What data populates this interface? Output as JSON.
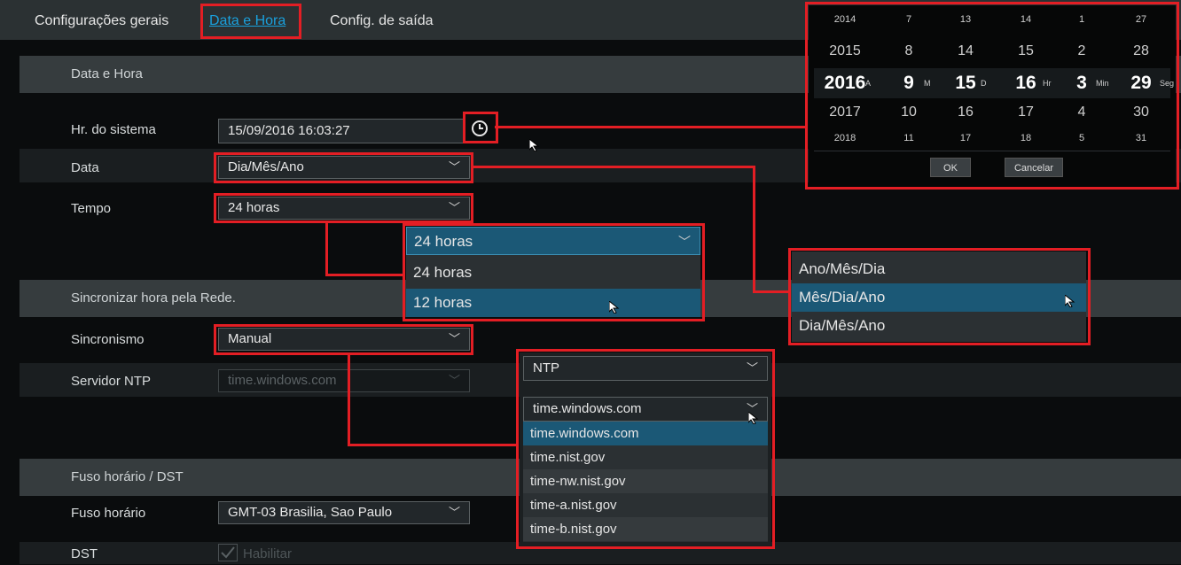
{
  "tabs": [
    "Configurações gerais",
    "Data e Hora",
    "Config. de saída"
  ],
  "sections": {
    "date_time": "Data e Hora",
    "network_sync": "Sincronizar hora pela Rede.",
    "timezone_dst": "Fuso horário / DST"
  },
  "fields": {
    "system_time_label": "Hr. do sistema",
    "system_time_value": "15/09/2016 16:03:27",
    "date_label": "Data",
    "date_value": "Dia/Mês/Ano",
    "time_label": "Tempo",
    "time_value": "24 horas",
    "sync_label": "Sincronismo",
    "sync_value": "Manual",
    "ntp_label": "Servidor NTP",
    "ntp_value": "time.windows.com",
    "tz_label": "Fuso horário",
    "tz_value": "GMT-03 Brasilia, Sao Paulo",
    "dst_label": "DST",
    "dst_enable": "Habilitar"
  },
  "time_dropdown": {
    "selected": "24 horas",
    "options": [
      "24 horas",
      "12 horas"
    ]
  },
  "date_dropdown": {
    "options": [
      "Ano/Mês/Dia",
      "Mês/Dia/Ano",
      "Dia/Mês/Ano"
    ]
  },
  "sync_dropdown": {
    "selected": "NTP",
    "ntp_selected": "time.windows.com",
    "servers": [
      "time.windows.com",
      "time.nist.gov",
      "time-nw.nist.gov",
      "time-a.nist.gov",
      "time-b.nist.gov"
    ]
  },
  "datetime_picker": {
    "rows": [
      [
        "2014",
        "7",
        "13",
        "14",
        "1",
        "27"
      ],
      [
        "2015",
        "8",
        "14",
        "15",
        "2",
        "28"
      ],
      [
        "2016",
        "9",
        "15",
        "16",
        "3",
        "29"
      ],
      [
        "2017",
        "10",
        "16",
        "17",
        "4",
        "30"
      ],
      [
        "2018",
        "11",
        "17",
        "18",
        "5",
        "31"
      ]
    ],
    "units": [
      "A",
      "M",
      "D",
      "Hr",
      "Min",
      "Seg"
    ],
    "ok": "OK",
    "cancel": "Cancelar"
  },
  "colors": {
    "highlight_red": "#e31e24",
    "tab_active": "#1aa0dc",
    "selected_item": "#1b5876"
  },
  "icons": {
    "clock": "clock-icon",
    "chevron": "chevron-down-icon",
    "cursor": "mouse-cursor-icon",
    "checkbox": "checkbox-icon"
  }
}
